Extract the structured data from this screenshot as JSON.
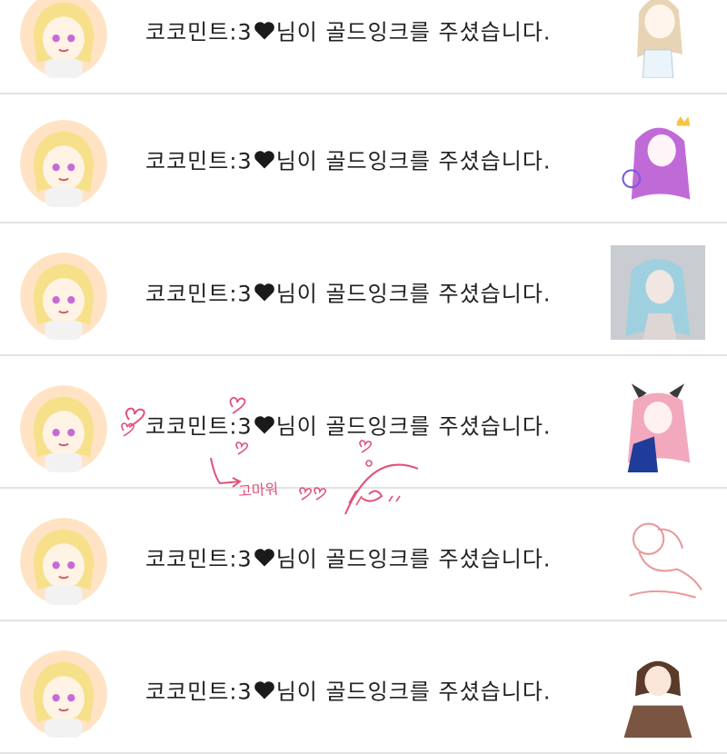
{
  "notifications": [
    {
      "prefix": "코코민트:3",
      "suffix": "님이 골드잉크를 주셨습니다."
    },
    {
      "prefix": "코코민트:3",
      "suffix": "님이 골드잉크를 주셨습니다."
    },
    {
      "prefix": "코코민트:3",
      "suffix": "님이 골드잉크를 주셨습니다."
    },
    {
      "prefix": "코코민트:3",
      "suffix": "님이 골드잉크를 주셨습니다."
    },
    {
      "prefix": "코코민트:3",
      "suffix": "님이 골드잉크를 주셨습니다."
    },
    {
      "prefix": "코코민트:3",
      "suffix": "님이 골드잉크를 주셨습니다."
    }
  ],
  "handwritten_note": "고마워",
  "colors": {
    "divider": "#e3e3e3",
    "text": "#222222",
    "heart": "#1a1a1a",
    "doodle": "#e0527a"
  }
}
